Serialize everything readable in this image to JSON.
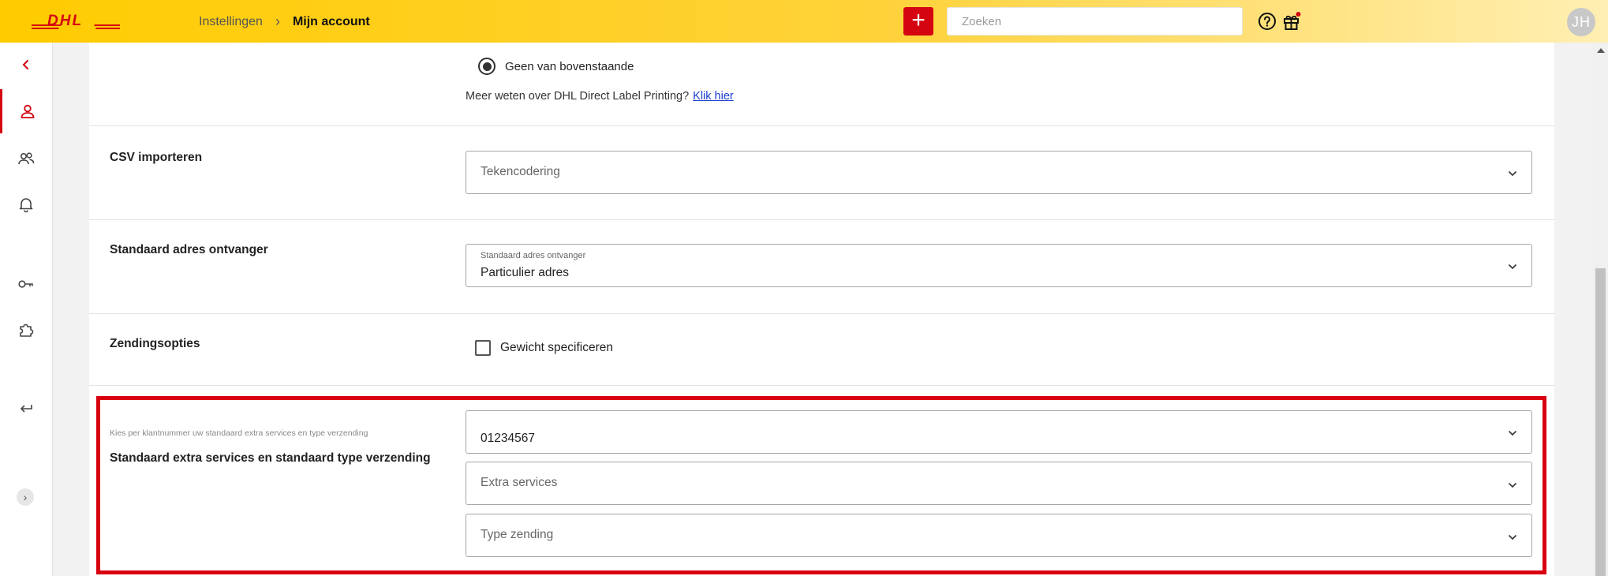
{
  "header": {
    "logo": "DHL",
    "breadcrumb": [
      "Instellingen",
      "Mijn account"
    ],
    "add_label": "+",
    "search_placeholder": "Zoeken",
    "avatar_initials": "JH"
  },
  "sidebar": {
    "items": [
      "back-icon",
      "user-icon",
      "users-icon",
      "bell-icon",
      "key-icon",
      "puzzle-icon",
      "logout-icon"
    ],
    "active": "user-icon",
    "toggle_label": "›"
  },
  "label_printing": {
    "radio_label": "Geen van bovenstaande",
    "info_text": "Meer weten over DHL Direct Label Printing?",
    "info_link": "Klik hier"
  },
  "csv": {
    "title": "CSV importeren",
    "select_placeholder": "Tekencodering"
  },
  "standaard_adres": {
    "title": "Standaard adres ontvanger",
    "select_label": "Standaard adres ontvanger",
    "select_value": "Particulier adres"
  },
  "zendingsopties": {
    "title": "Zendingsopties",
    "checkbox_label": "Gewicht specificeren",
    "checked": false
  },
  "extra_services": {
    "title": "Standaard extra services en standaard type verzending",
    "subtitle": "Kies per klantnummer uw standaard extra services en type verzending",
    "account_value": "01234567",
    "extra_placeholder": "Extra services",
    "type_placeholder": "Type zending"
  },
  "colors": {
    "brand_yellow": "#ffcc00",
    "brand_red": "#d40511",
    "highlight_red": "#d8000f"
  }
}
